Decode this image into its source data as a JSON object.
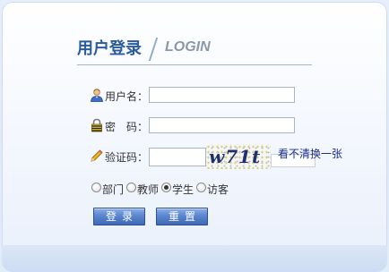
{
  "header": {
    "title_cn": "用户登录",
    "title_en": "LOGIN"
  },
  "form": {
    "username": {
      "label": "用户名：",
      "value": "",
      "icon": "user-icon"
    },
    "password": {
      "label": "密　码：",
      "value": "",
      "icon": "lock-icon"
    },
    "captcha": {
      "label": "验证码：",
      "value": "",
      "icon": "pencil-icon",
      "image_text": "w71t",
      "refresh_label": "看不清换一张"
    }
  },
  "roles": {
    "options": [
      {
        "label": "部门",
        "checked": false
      },
      {
        "label": "教师",
        "checked": false
      },
      {
        "label": "学生",
        "checked": true
      },
      {
        "label": "访客",
        "checked": false
      }
    ]
  },
  "buttons": {
    "login": "登录",
    "reset": "重置"
  },
  "colors": {
    "title": "#2a5aa0",
    "accent_button": "#4a76c2",
    "link": "#1a2f8a"
  }
}
